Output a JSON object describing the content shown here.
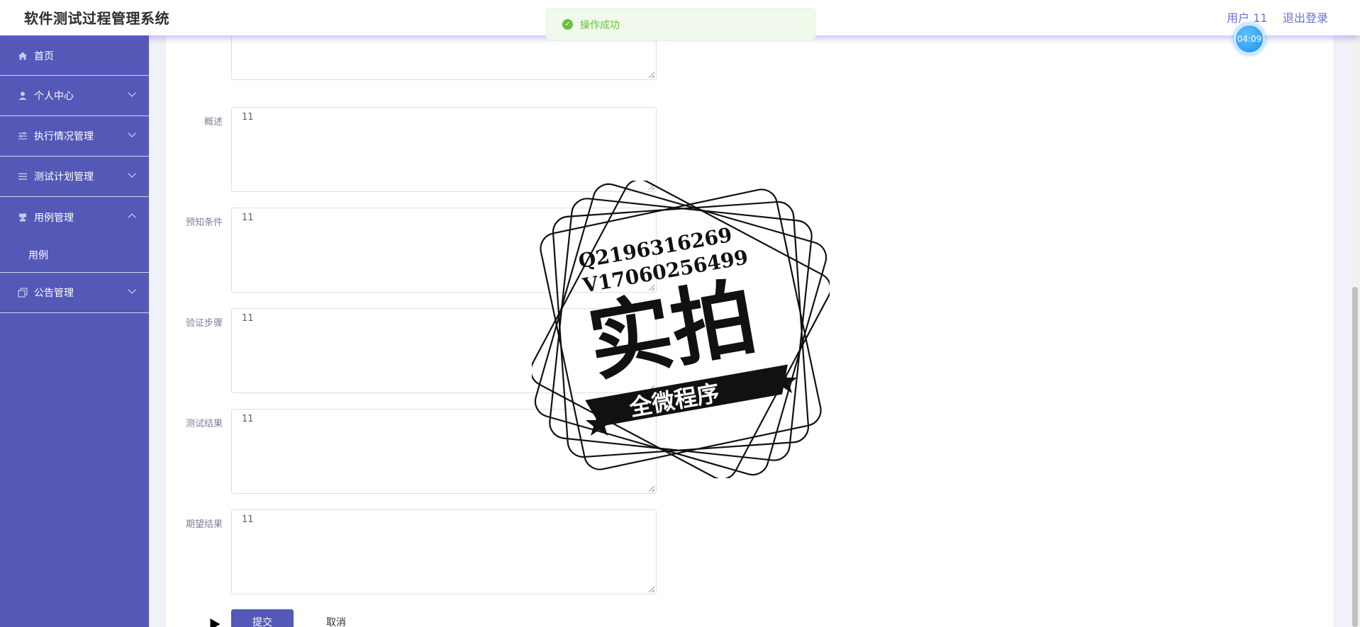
{
  "header": {
    "title": "软件测试过程管理系统",
    "user": "用户 11",
    "logout": "退出登录",
    "timer": "04:09"
  },
  "toast": {
    "message": "操作成功",
    "icon": "check-circle-icon",
    "color": "#67c23a"
  },
  "sidebar": {
    "items": [
      {
        "label": "首页",
        "icon": "home-icon",
        "has_chevron": false
      },
      {
        "label": "个人中心",
        "icon": "user-icon",
        "has_chevron": true,
        "expanded": false
      },
      {
        "label": "执行情况管理",
        "icon": "sliders-icon",
        "has_chevron": true,
        "expanded": false
      },
      {
        "label": "测试计划管理",
        "icon": "list-icon",
        "has_chevron": true,
        "expanded": false
      },
      {
        "label": "用例管理",
        "icon": "stamp-icon",
        "has_chevron": true,
        "expanded": true,
        "children": [
          "用例"
        ]
      },
      {
        "label": "公告管理",
        "icon": "copy-icon",
        "has_chevron": true,
        "expanded": false
      }
    ]
  },
  "form": {
    "fields": [
      {
        "label": "",
        "value": ""
      },
      {
        "label": "概述",
        "value": "11"
      },
      {
        "label": "预知条件",
        "value": "11"
      },
      {
        "label": "验证步骤",
        "value": "11"
      },
      {
        "label": "测试结果",
        "value": "11"
      },
      {
        "label": "期望结果",
        "value": "11"
      }
    ],
    "submit": "提交",
    "cancel": "取消"
  },
  "watermark": {
    "line1": "Q2196316269",
    "line2": "V17060256499",
    "big": "实拍",
    "banner": "全微程序"
  },
  "colors": {
    "sidebar": "#5458b6",
    "accent": "#6b6fd1",
    "success": "#67c23a"
  }
}
